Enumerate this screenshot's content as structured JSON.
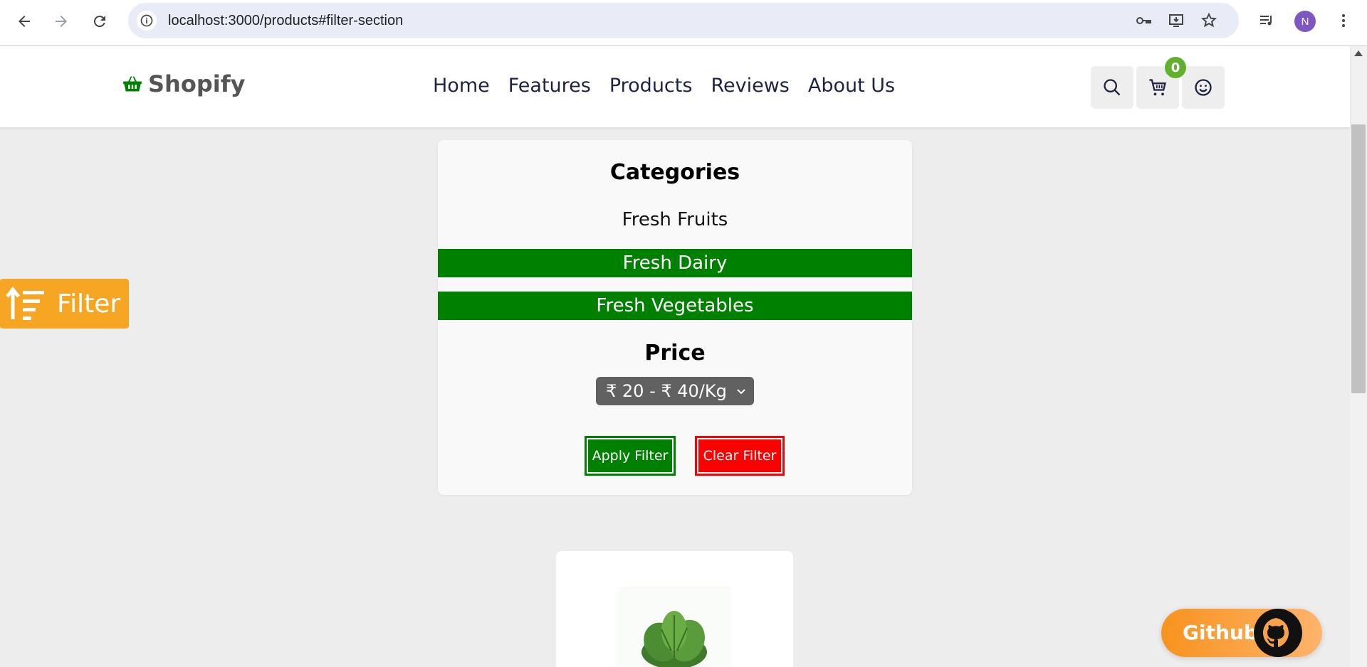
{
  "browser": {
    "url": "localhost:3000/products#filter-section",
    "profile_initial": "N"
  },
  "header": {
    "logo_text": "Shopify",
    "nav": [
      "Home",
      "Features",
      "Products",
      "Reviews",
      "About Us"
    ],
    "cart_count": "0"
  },
  "filter_toggle": {
    "label": "Filter"
  },
  "filter_panel": {
    "categories_heading": "Categories",
    "categories": [
      {
        "label": "Fresh Fruits",
        "active": false
      },
      {
        "label": "Fresh Dairy",
        "active": true
      },
      {
        "label": "Fresh Vegetables",
        "active": true
      }
    ],
    "price_heading": "Price",
    "price_selected": "₹ 20 - ₹ 40/Kg",
    "apply_label": "Apply Filter",
    "clear_label": "Clear Filter"
  },
  "github": {
    "label": "Github"
  },
  "colors": {
    "accent_orange": "#f6a623",
    "active_green": "#008000",
    "clear_red": "#ff0000",
    "badge_green": "#62b12e"
  }
}
